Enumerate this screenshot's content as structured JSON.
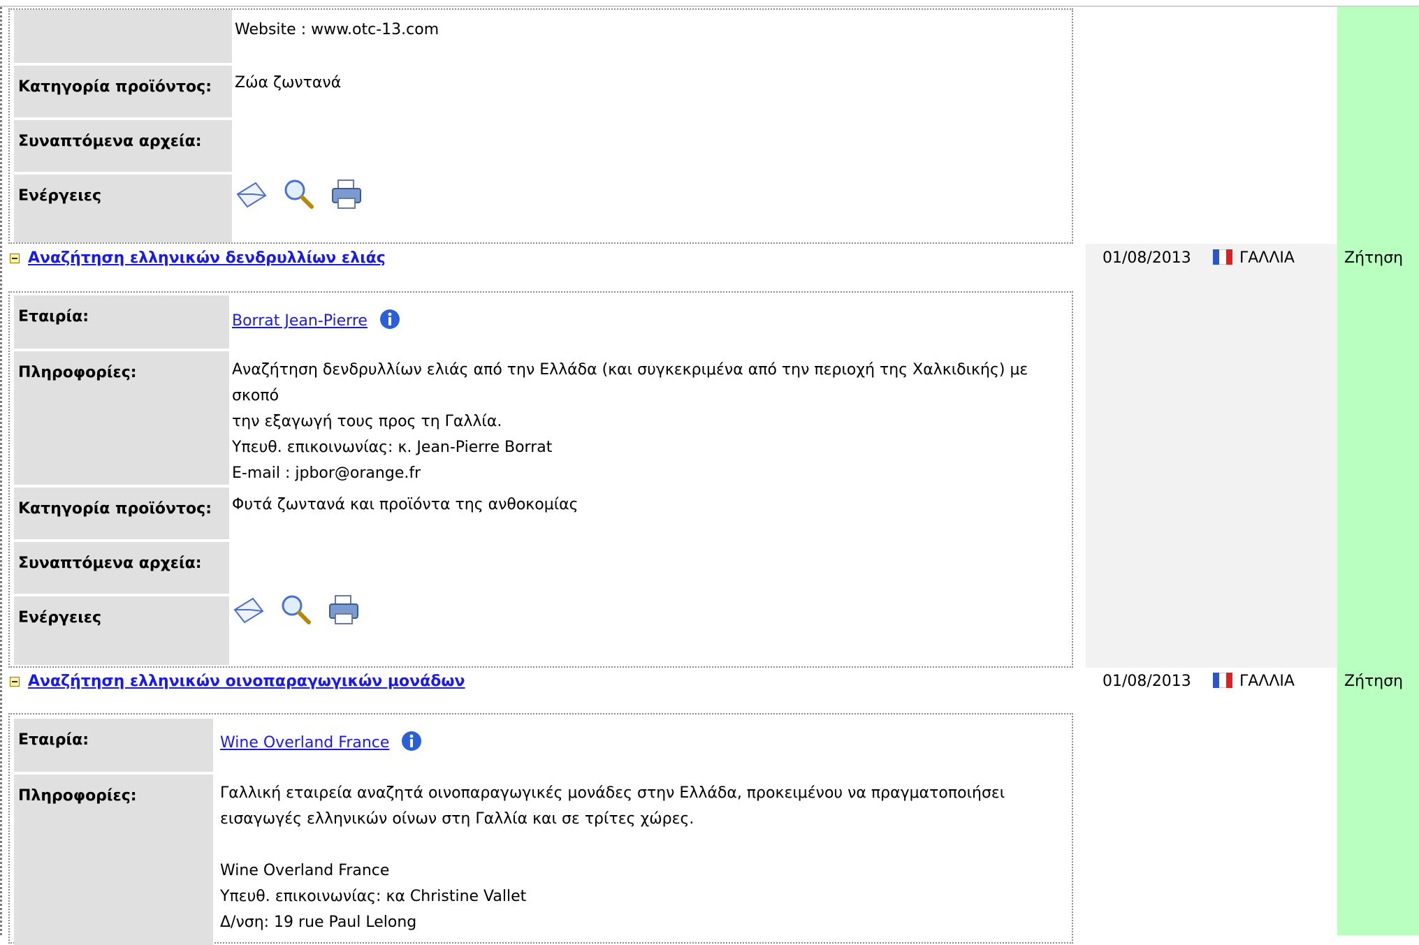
{
  "labels": {
    "company": "Εταιρία:",
    "info": "Πληροφορίες:",
    "category": "Κατηγορία προϊόντος:",
    "attachments": "Συναπτόμενα αρχεία:",
    "actions": "Ενέργειες"
  },
  "top_entry": {
    "website": "Website : www.otc-13.com",
    "category": "Ζώα ζωντανά"
  },
  "entries": [
    {
      "title": "Αναζήτηση ελληνικών δενδρυλλίων ελιάς",
      "date": "01/08/2013",
      "country": "ΓΑΛΛΙΑ",
      "type": "Ζήτηση",
      "company": "Borrat Jean-Pierre",
      "info_lines": [
        "Αναζήτηση δενδρυλλίων ελιάς από την Ελλάδα (και συγκεκριμένα από την περιοχή της Χαλκιδικής) με σκοπό",
        "την εξαγωγή τους προς τη Γαλλία.",
        "Υπευθ. επικοινωνίας: κ. Jean-Pierre Borrat",
        "E-mail : jpbor@orange.fr"
      ],
      "category": "Φυτά ζωντανά και προϊόντα της ανθοκομίας"
    },
    {
      "title": "Αναζήτηση ελληνικών οινοπαραγωγικών μονάδων",
      "date": "01/08/2013",
      "country": "ΓΑΛΛΙΑ",
      "type": "Ζήτηση",
      "company": "Wine Overland France",
      "info_lines": [
        "Γαλλική εταιρεία αναζητά οινοπαραγωγικές μονάδες στην Ελλάδα, προκειμένου να πραγματοποιήσει",
        "εισαγωγές ελληνικών οίνων στη Γαλλία και σε τρίτες χώρες.",
        "",
        "Wine Overland France",
        "Υπευθ. επικοινωνίας: κα Christine Vallet",
        "Δ/νση: 19 rue Paul Lelong"
      ]
    }
  ],
  "icons": [
    "envelope-icon",
    "magnifier-icon",
    "printer-icon",
    "minus-toggle-icon",
    "info-icon",
    "france-flag-icon"
  ],
  "colors": {
    "link": "#1a1ae8",
    "label_bg": "#e0e0e0",
    "type_column_bg": "#b8ffc0",
    "header_band_bg": "#f2f2f2",
    "flag_blue": "#2d54c8",
    "flag_red": "#e02020"
  }
}
